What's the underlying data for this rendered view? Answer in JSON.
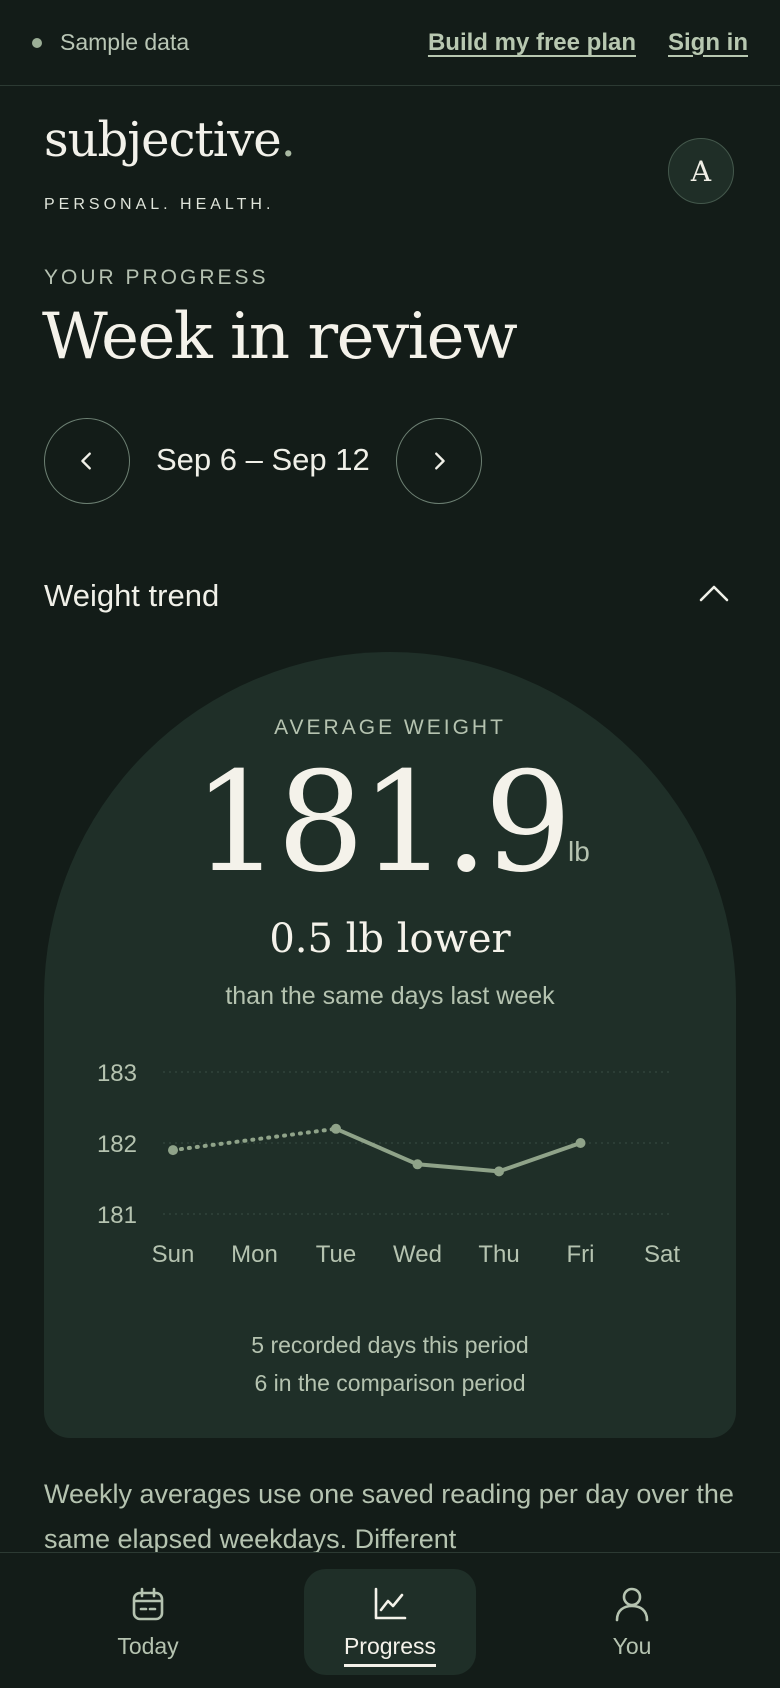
{
  "topbar": {
    "sample_label": "Sample data",
    "build_plan": "Build my free plan",
    "sign_in": "Sign in"
  },
  "brand": {
    "name": "subjective",
    "name_period": ".",
    "tagline": "PERSONAL. HEALTH."
  },
  "avatar": {
    "initial": "A"
  },
  "header": {
    "eyebrow": "YOUR PROGRESS",
    "title": "Week in review",
    "date_range": "Sep 6 – Sep 12",
    "prev_icon": "chevron-left-icon",
    "next_icon": "chevron-right-icon"
  },
  "weight_section": {
    "title": "Weight trend",
    "collapse_icon": "chevron-up-icon",
    "average_label": "AVERAGE WEIGHT",
    "average_value": "181.9",
    "unit": "lb",
    "delta": "0.5 lb lower",
    "delta_subtitle": "than the same days last week",
    "recorded_note": "5 recorded days this period",
    "comparison_note": "6 in the comparison period"
  },
  "chart_data": {
    "type": "line",
    "categories": [
      "Sun",
      "Mon",
      "Tue",
      "Wed",
      "Thu",
      "Fri",
      "Sat"
    ],
    "ytick_labels": [
      "183",
      "182",
      "181"
    ],
    "ylim": [
      181,
      183
    ],
    "series": [
      {
        "values": [
          181.9,
          null,
          182.2,
          181.7,
          181.6,
          182.0,
          null
        ]
      }
    ],
    "interpolated_segment": [
      "Sun",
      "Tue"
    ],
    "grid": true,
    "line_color": "#8fa389",
    "grid_color": "#3a4d43"
  },
  "footnote": "Weekly averages use one saved reading per day over the same elapsed weekdays. Different",
  "bottom_nav": {
    "tabs": [
      {
        "label": "Today",
        "icon": "calendar-icon",
        "active": false
      },
      {
        "label": "Progress",
        "icon": "chart-icon",
        "active": true
      },
      {
        "label": "You",
        "icon": "user-icon",
        "active": false
      }
    ]
  },
  "colors": {
    "background": "#131c18",
    "card": "#1f2f28",
    "accent": "#a9b9a2"
  }
}
